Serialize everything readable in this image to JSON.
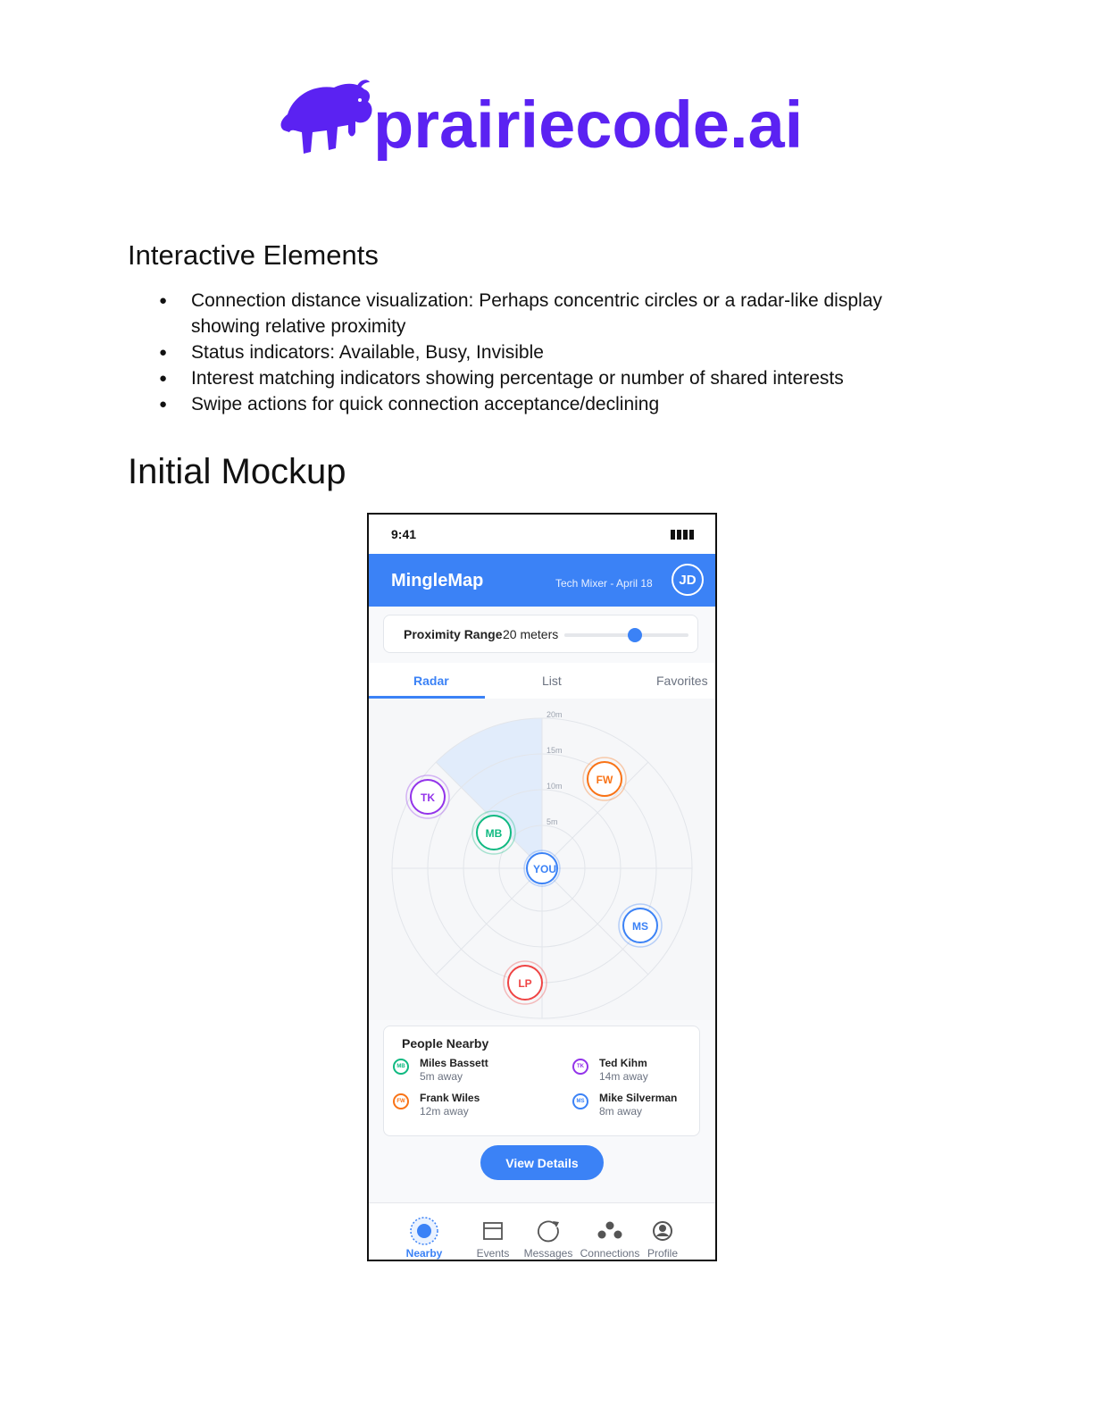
{
  "logo": {
    "text": "prairiecode.ai",
    "icon": "bison-icon",
    "color": "#5b22f2"
  },
  "section_interactive": {
    "heading": "Interactive Elements",
    "bullets": [
      "Connection distance visualization: Perhaps concentric circles or a radar-like display showing relative proximity",
      "Status indicators: Available, Busy, Invisible",
      "Interest matching indicators showing percentage or number of shared interests",
      "Swipe actions for quick connection acceptance/declining"
    ]
  },
  "section_mockup": {
    "heading": "Initial Mockup"
  },
  "phone": {
    "status_bar": {
      "time": "9:41",
      "icon": "battery-icon"
    },
    "header": {
      "app_name": "MingleMap",
      "event": "Tech Mixer - April 18",
      "user_initials": "JD",
      "accent_color": "#3b82f6"
    },
    "proximity": {
      "label": "Proximity Range",
      "value_text": "20 meters",
      "slider_fraction": 0.57
    },
    "tabs": [
      {
        "label": "Radar",
        "active": true
      },
      {
        "label": "List",
        "active": false
      },
      {
        "label": "Favorites",
        "active": false
      }
    ],
    "radar": {
      "ring_labels": [
        "20m",
        "15m",
        "10m",
        "5m"
      ],
      "center_label": "YOU",
      "people": [
        {
          "initials": "TK",
          "color": "#9333ea"
        },
        {
          "initials": "FW",
          "color": "#f97316"
        },
        {
          "initials": "MB",
          "color": "#10b981"
        },
        {
          "initials": "MS",
          "color": "#3b82f6"
        },
        {
          "initials": "LP",
          "color": "#ef4444"
        }
      ]
    },
    "people_nearby": {
      "title": "People Nearby",
      "items": [
        {
          "initials": "MB",
          "name": "Miles Bassett",
          "distance": "5m away",
          "color": "#10b981"
        },
        {
          "initials": "TK",
          "name": "Ted Kihm",
          "distance": "14m away",
          "color": "#9333ea"
        },
        {
          "initials": "FW",
          "name": "Frank Wiles",
          "distance": "12m away",
          "color": "#f97316"
        },
        {
          "initials": "MS",
          "name": "Mike Silverman",
          "distance": "8m away",
          "color": "#3b82f6"
        }
      ]
    },
    "view_details_label": "View Details",
    "bottom_nav": [
      {
        "label": "Nearby",
        "icon": "radar-dot-icon",
        "active": true
      },
      {
        "label": "Events",
        "icon": "calendar-icon",
        "active": false
      },
      {
        "label": "Messages",
        "icon": "chat-bubble-icon",
        "active": false
      },
      {
        "label": "Connections",
        "icon": "network-icon",
        "active": false
      },
      {
        "label": "Profile",
        "icon": "user-circle-icon",
        "active": false
      }
    ]
  }
}
